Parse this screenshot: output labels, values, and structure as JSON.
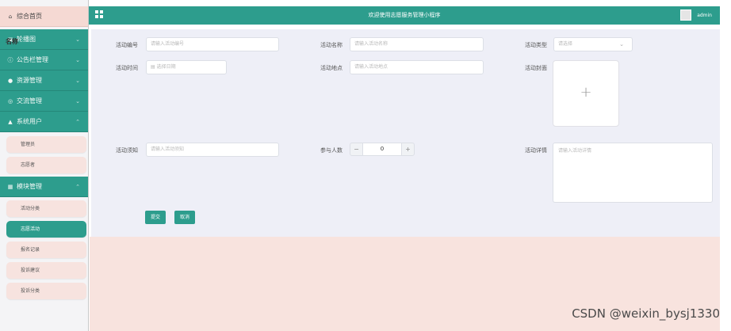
{
  "sidebar": {
    "home": "综合首页",
    "overlay_label": "名称",
    "menus": [
      {
        "label": "轮播图",
        "icon": "image-icon"
      },
      {
        "label": "公告栏管理",
        "icon": "info-circle-icon"
      },
      {
        "label": "资源管理",
        "icon": "bulb-icon"
      },
      {
        "label": "交流管理",
        "icon": "chat-icon"
      },
      {
        "label": "系统用户",
        "icon": "user-icon"
      },
      {
        "label": "模块管理",
        "icon": "grid-icon"
      }
    ],
    "system_users_sub": [
      "管理员",
      "志愿者"
    ],
    "module_sub": [
      "活动分类",
      "志愿活动",
      "报名记录",
      "投诉建议",
      "投诉分类"
    ]
  },
  "topbar": {
    "title": "欢迎使用志愿服务管理小程序",
    "user": "admin"
  },
  "form": {
    "code_label": "活动编号",
    "code_placeholder": "请输入活动编号",
    "name_label": "活动名称",
    "name_placeholder": "请输入活动名称",
    "type_label": "活动类型",
    "type_placeholder": "请选择",
    "time_label": "活动时间",
    "time_placeholder": "选择日期",
    "place_label": "活动地点",
    "place_placeholder": "请输入活动地点",
    "cover_label": "活动封面",
    "notice_label": "活动须知",
    "notice_placeholder": "请输入活动须知",
    "count_label": "参与人数",
    "count_value": "0",
    "detail_label": "活动详情",
    "detail_placeholder": "请输入活动详情",
    "submit": "提交",
    "cancel": "取消"
  },
  "watermark": "CSDN @weixin_bysj1330",
  "colors": {
    "primary": "#2d9d8d",
    "pink": "#f7e3df",
    "form_bg": "#eeeff7"
  }
}
